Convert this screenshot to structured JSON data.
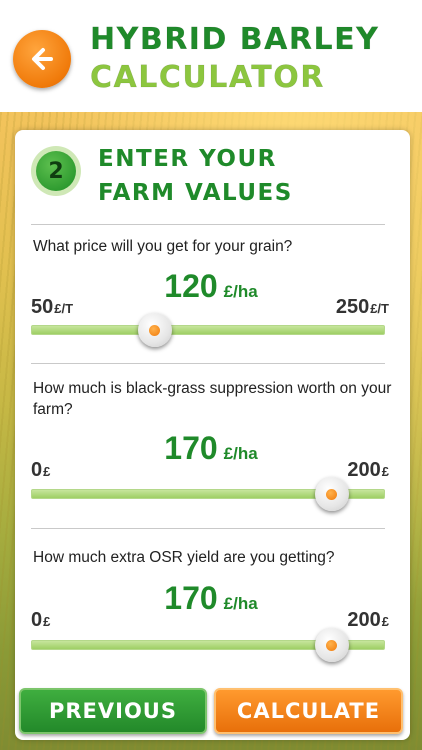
{
  "header": {
    "back_icon": "arrow-left-icon",
    "title_line1": "HYBRID BARLEY",
    "title_line2": "CALCULATOR"
  },
  "colors": {
    "brand_green": "#1f8a2a",
    "light_green": "#8cc63f",
    "accent_orange": "#f07a0a"
  },
  "step": {
    "number": "2",
    "title_line1": "ENTER YOUR",
    "title_line2": "FARM VALUES"
  },
  "sliders": [
    {
      "question": "What price will you get for your grain?",
      "value": "120",
      "unit": "£/ha",
      "min_value": "50",
      "min_unit": "£/T",
      "max_value": "250",
      "max_unit": "£/T",
      "level": 0.35
    },
    {
      "question": "How much is black-grass suppression worth on your farm?",
      "value": "170",
      "unit": "£/ha",
      "min_value": "0",
      "min_unit": "£",
      "max_value": "200",
      "max_unit": "£",
      "level": 0.85
    },
    {
      "question": "How much extra OSR yield are you getting?",
      "value": "170",
      "unit": "£/ha",
      "min_value": "0",
      "min_unit": "£",
      "max_value": "200",
      "max_unit": "£",
      "level": 0.85
    }
  ],
  "buttons": {
    "previous": "PREVIOUS",
    "calculate": "CALCULATE"
  }
}
